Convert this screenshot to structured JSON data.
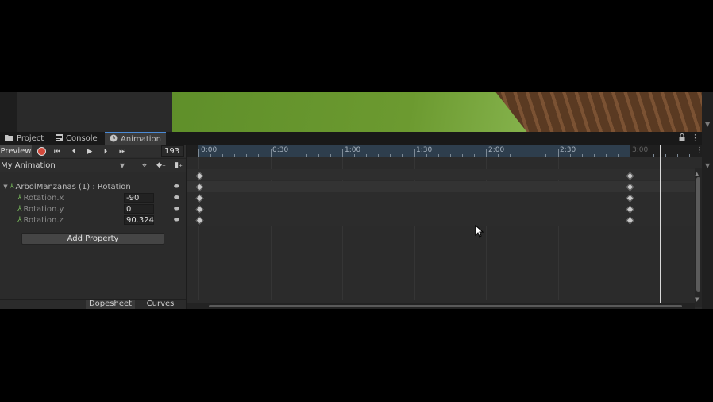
{
  "tabs": {
    "project": {
      "icon": "folder-icon",
      "label": "Project"
    },
    "console": {
      "icon": "console-icon",
      "label": "Console"
    },
    "animation": {
      "icon": "clock-icon",
      "label": "Animation"
    }
  },
  "toolbar": {
    "preview_label": "Preview",
    "frame_value": "193",
    "clip_name": "My Animation"
  },
  "properties": {
    "group_label": "ArbolManzanas (1) : Rotation",
    "rows": [
      {
        "name": "Rotation.x",
        "value": "-90"
      },
      {
        "name": "Rotation.y",
        "value": "0"
      },
      {
        "name": "Rotation.z",
        "value": "90.324"
      }
    ],
    "add_property_label": "Add Property"
  },
  "bottom_tabs": {
    "dopesheet": "Dopesheet",
    "curves": "Curves"
  },
  "timeline": {
    "ruler_labels": [
      "0:00",
      "0:30",
      "1:00",
      "1:30",
      "2:00",
      "2:30",
      "3:00"
    ],
    "keyframe_times": [
      "0:00",
      "3:00"
    ]
  },
  "colors": {
    "record": "#d4493b",
    "ruler_active": "#2e3e4d",
    "tab_accent": "#4a8ad6"
  }
}
